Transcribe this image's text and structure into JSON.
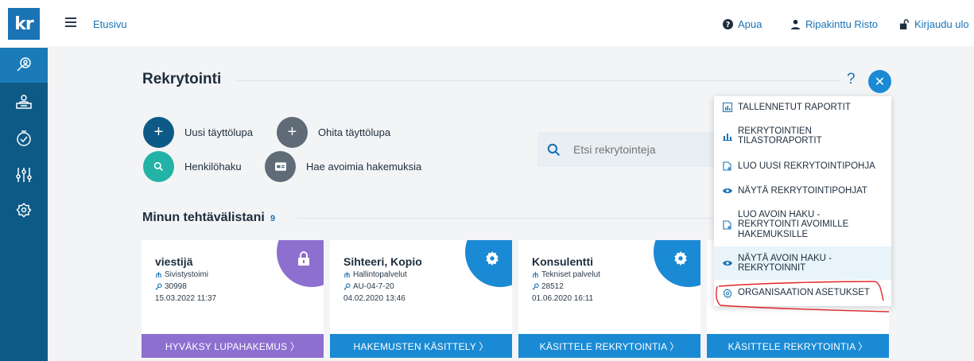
{
  "logo": "kr",
  "topbar": {
    "breadcrumb": "Etusivu",
    "help": "Apua",
    "user": "Ripakinttu Risto",
    "logout": "Kirjaudu ulo"
  },
  "page": {
    "title": "Rekrytointi",
    "help_mark": "?"
  },
  "actions": {
    "new_permit": "Uusi täyttölupa",
    "skip_permit": "Ohita täyttölupa",
    "person_search": "Henkilöhaku",
    "open_applications": "Hae avoimia hakemuksia"
  },
  "search": {
    "placeholder": "Etsi rekrytointeja"
  },
  "tasks": {
    "title": "Minun tehtävälistani",
    "count": "9"
  },
  "cards": [
    {
      "title": "viestijä",
      "unit": "Sivistystoimi",
      "code": "30998",
      "date": "15.03.2022 11:37",
      "button": "HYVÄKSY LUPAHAKEMUS  〉",
      "color": "#8d6fcf"
    },
    {
      "title": "Sihteeri, Kopio",
      "unit": "Hallintopalvelut",
      "code": "AU-04-7-20",
      "date": "04.02.2020 13:46",
      "button": "HAKEMUSTEN KÄSITTELY  〉",
      "color": "#1a8ad4"
    },
    {
      "title": "Konsulentti",
      "unit": "Tekniset palvelut",
      "code": "28512",
      "date": "01.06.2020 16:11",
      "button": "KÄSITTELE REKRYTOINTIA  〉",
      "color": "#1a8ad4"
    },
    {
      "button": "KÄSITTELE REKRYTOINTIA  〉",
      "color": "#1a8ad4"
    }
  ],
  "menu": {
    "items": [
      {
        "label": "TALLENNETUT RAPORTIT",
        "icon": "report-icon"
      },
      {
        "label_1": "REKRYTOINTIEN",
        "label_2": "TILASTORAPORTIT",
        "icon": "bar-chart-icon"
      },
      {
        "label": "LUO UUSI REKRYTOINTIPOHJA",
        "icon": "new-document-icon"
      },
      {
        "label": "NÄYTÄ REKRYTOINTIPOHJAT",
        "icon": "eye-icon"
      },
      {
        "label_1": "LUO AVOIN HAKU -",
        "label_2": "REKRYTOINTI AVOIMILLE",
        "label_3": "HAKEMUKSILLE",
        "icon": "new-document-icon"
      },
      {
        "label_1": "NÄYTÄ AVOIN HAKU -",
        "label_2": "REKRYTOINNIT",
        "icon": "eye-icon"
      },
      {
        "label": "ORGANISAATION ASETUKSET",
        "icon": "gear-icon"
      }
    ]
  },
  "colors": {
    "sidebar": "#0e5a86",
    "accent": "#1a8ad4",
    "dark_circle": "#0e5a86",
    "gray_circle": "#5f6b77",
    "teal_circle": "#22b3a6",
    "purple": "#8d6fcf"
  }
}
